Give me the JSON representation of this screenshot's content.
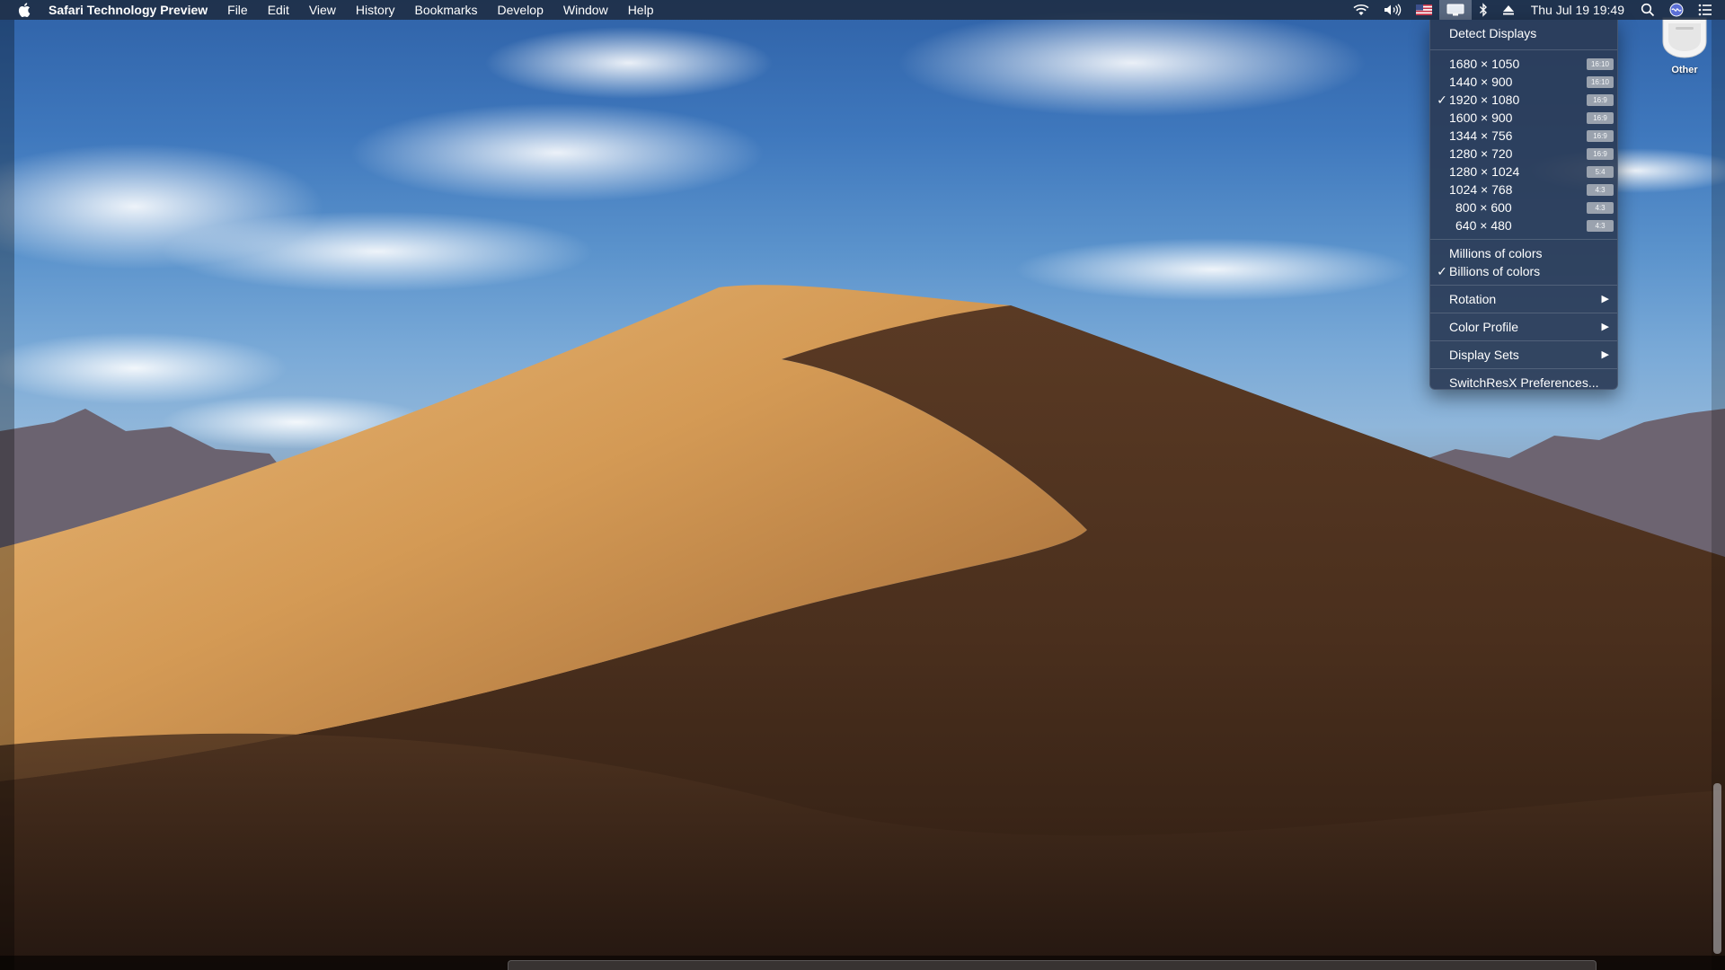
{
  "menubar": {
    "apple_icon": "apple-logo-icon",
    "app_name": "Safari Technology Preview",
    "items": [
      "File",
      "Edit",
      "View",
      "History",
      "Bookmarks",
      "Develop",
      "Window",
      "Help"
    ],
    "status_icons": [
      "wifi-icon",
      "volume-icon",
      "us-flag-icon",
      "display-icon",
      "bluetooth-icon",
      "eject-icon"
    ],
    "clock": "Thu Jul 19  19:49",
    "right_icons": [
      "spotlight-icon",
      "siri-icon",
      "notification-center-icon"
    ]
  },
  "display_menu": {
    "detect_displays": "Detect Displays",
    "resolutions": [
      {
        "label": "1680 × 1050",
        "ratio": "16:10",
        "checked": false,
        "indent": false
      },
      {
        "label": "1440 × 900",
        "ratio": "16:10",
        "checked": false,
        "indent": false
      },
      {
        "label": "1920 × 1080",
        "ratio": "16:9",
        "checked": true,
        "indent": false
      },
      {
        "label": "1600 × 900",
        "ratio": "16:9",
        "checked": false,
        "indent": false
      },
      {
        "label": "1344 × 756",
        "ratio": "16:9",
        "checked": false,
        "indent": false
      },
      {
        "label": "1280 × 720",
        "ratio": "16:9",
        "checked": false,
        "indent": false
      },
      {
        "label": "1280 × 1024",
        "ratio": "5:4",
        "checked": false,
        "indent": false
      },
      {
        "label": "1024 × 768",
        "ratio": "4:3",
        "checked": false,
        "indent": false
      },
      {
        "label": "800 × 600",
        "ratio": "4:3",
        "checked": false,
        "indent": true
      },
      {
        "label": "640 × 480",
        "ratio": "4:3",
        "checked": false,
        "indent": true
      }
    ],
    "colors": [
      {
        "label": "Millions of colors",
        "checked": false
      },
      {
        "label": "Billions of colors",
        "checked": true
      }
    ],
    "check_mark": "✓",
    "rotation": "Rotation",
    "color_profile": "Color Profile",
    "display_sets": "Display Sets",
    "submenu_arrow": "▶",
    "preferences": "SwitchResX Preferences..."
  },
  "desktop": {
    "drive_label": "Other",
    "drive_icon": "external-drive-icon"
  }
}
